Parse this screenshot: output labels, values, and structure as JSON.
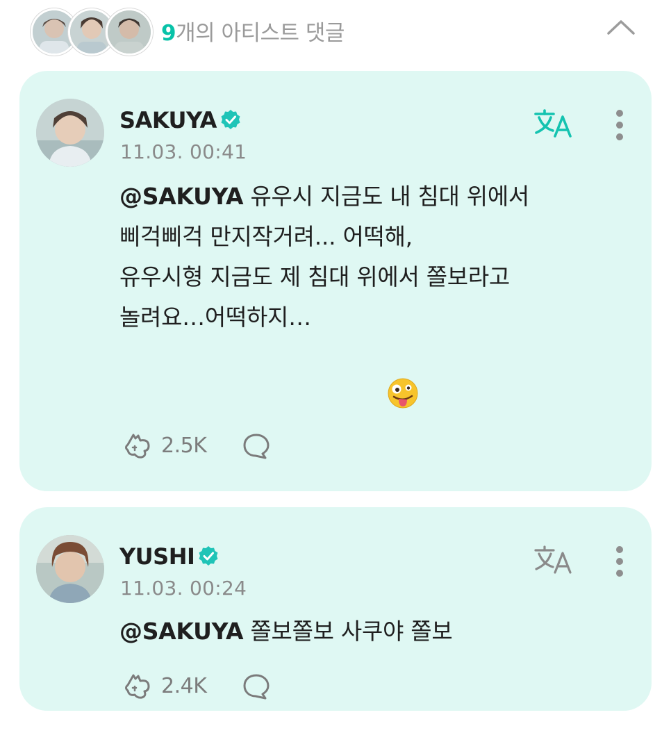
{
  "header": {
    "count": "9",
    "label": "개의 아티스트 댓글"
  },
  "colors": {
    "accent": "#08c2a8",
    "card_bg": "#dff8f3",
    "muted": "#8a8a8a"
  },
  "comments": [
    {
      "author": "SAKUYA",
      "verified": true,
      "timestamp": "11.03. 00:41",
      "mention": "@SAKUYA",
      "lines": [
        " 유우시 지금도 내 침대 위에서",
        "삐걱삐걱 만지작거려... 어떡해,",
        "유우시형 지금도 제 침대 위에서 쫄보라고",
        "놀려요…어떡하지…"
      ],
      "emoji": "zany-face",
      "likes": "2.5K",
      "translate_active": true
    },
    {
      "author": "YUSHI",
      "verified": true,
      "timestamp": "11.03. 00:24",
      "mention": "@SAKUYA",
      "lines": [
        " 쫄보쫄보 사쿠야 쫄보"
      ],
      "likes": "2.4K",
      "translate_active": false
    }
  ]
}
